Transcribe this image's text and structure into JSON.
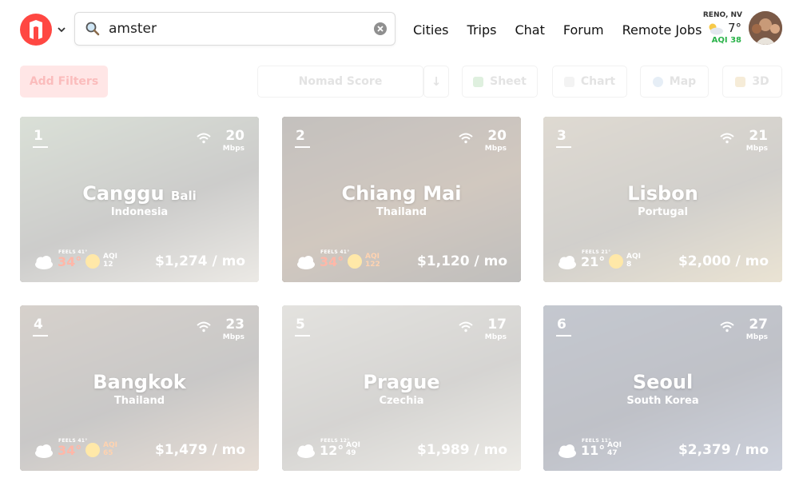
{
  "header": {
    "search": {
      "value": "amster"
    },
    "nav": [
      "Cities",
      "Trips",
      "Chat",
      "Forum",
      "Remote Jobs"
    ],
    "weather": {
      "location": "RENO, NV",
      "temp": "7°",
      "aqi": "AQI 38"
    }
  },
  "toolbar": {
    "add_filters": "Add Filters",
    "sort_by": "Nomad Score",
    "sort_dir_icon": "arrow-down",
    "views": [
      {
        "label": "Sheet",
        "icon": "sheet-icon"
      },
      {
        "label": "Chart",
        "icon": "chart-icon"
      },
      {
        "label": "Map",
        "icon": "globe-icon"
      },
      {
        "label": "3D",
        "icon": "cube-icon"
      }
    ]
  },
  "cards": [
    {
      "rank": "1",
      "city": "Canggu",
      "sub": "Bali",
      "country": "Indonesia",
      "wifi": "20",
      "wifi_unit": "Mbps",
      "feels": "FEELS 41°",
      "temp": "34°",
      "aqi_label": "AQI",
      "aqi_value": "12",
      "cost": "$1,274 / mo",
      "bg": [
        "#7a8f70",
        "#4b4a45",
        "#b9b1a2"
      ]
    },
    {
      "rank": "2",
      "city": "Chiang Mai",
      "sub": "",
      "country": "Thailand",
      "wifi": "20",
      "wifi_unit": "Mbps",
      "feels": "FEELS 41°",
      "temp": "34°",
      "aqi_label": "AQI",
      "aqi_value": "122",
      "cost": "$1,120 / mo",
      "bg": [
        "#2b2017",
        "#5a3a1c",
        "#1e1913"
      ]
    },
    {
      "rank": "3",
      "city": "Lisbon",
      "sub": "",
      "country": "Portugal",
      "wifi": "21",
      "wifi_unit": "Mbps",
      "feels": "FEELS 21°",
      "temp": "21°",
      "aqi_label": "AQI",
      "aqi_value": "8",
      "cost": "$2,000 / mo",
      "bg": [
        "#8b7a5d",
        "#5c5548",
        "#b49b62"
      ]
    },
    {
      "rank": "4",
      "city": "Bangkok",
      "sub": "",
      "country": "Thailand",
      "wifi": "23",
      "wifi_unit": "Mbps",
      "feels": "FEELS 41°",
      "temp": "34°",
      "aqi_label": "AQI",
      "aqi_value": "65",
      "cost": "$1,479 / mo",
      "bg": [
        "#6d5a48",
        "#3f3b38",
        "#a8876a"
      ]
    },
    {
      "rank": "5",
      "city": "Prague",
      "sub": "",
      "country": "Czechia",
      "wifi": "17",
      "wifi_unit": "Mbps",
      "feels": "FEELS 12°",
      "temp": "12°",
      "aqi_label": "AQI",
      "aqi_value": "49",
      "cost": "$1,989 / mo",
      "bg": [
        "#9b978b",
        "#6a665e",
        "#bcb6a6"
      ]
    },
    {
      "rank": "6",
      "city": "Seoul",
      "sub": "",
      "country": "South Korea",
      "wifi": "27",
      "wifi_unit": "Mbps",
      "feels": "FEELS 11°",
      "temp": "11°",
      "aqi_label": "AQI",
      "aqi_value": "47",
      "cost": "$2,379 / mo",
      "bg": [
        "#2d3a55",
        "#1b2238",
        "#4d5b80"
      ]
    }
  ],
  "colors": {
    "brand": "#ff4742",
    "aqi_good": "#2bb34a"
  }
}
